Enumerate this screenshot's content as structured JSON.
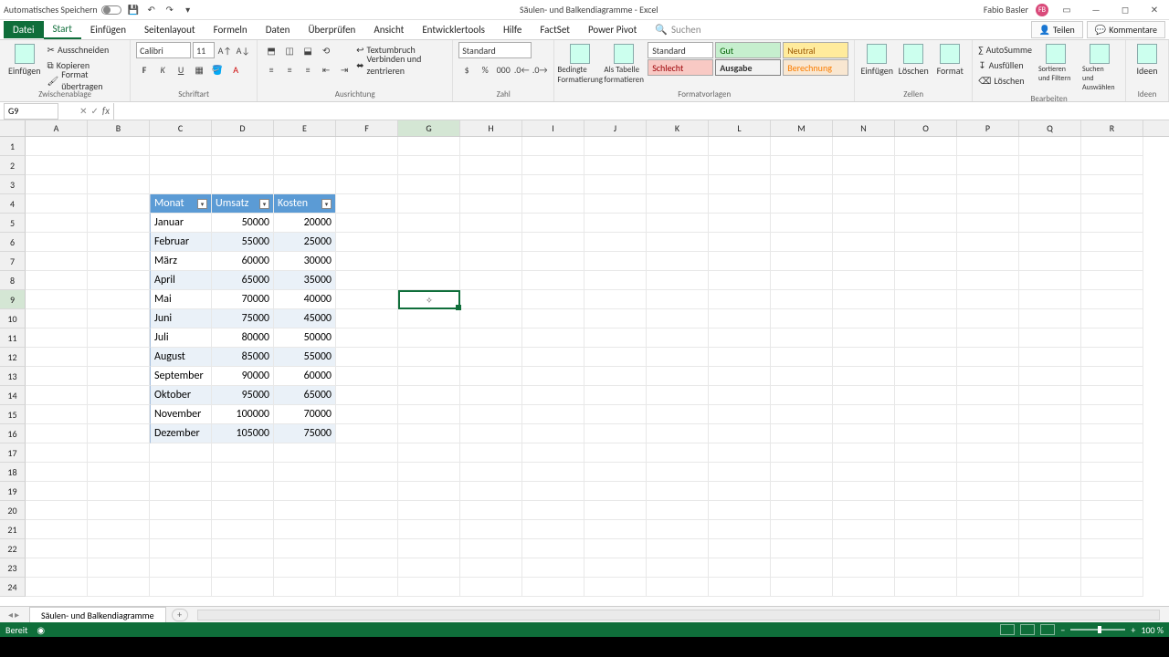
{
  "titlebar": {
    "autosave_label": "Automatisches Speichern",
    "doc_title": "Säulen- und Balkendiagramme - Excel",
    "user_name": "Fabio Basler",
    "avatar_initials": "FB"
  },
  "tabs": {
    "file": "Datei",
    "start": "Start",
    "einfugen": "Einfügen",
    "seitenlayout": "Seitenlayout",
    "formeln": "Formeln",
    "daten": "Daten",
    "uberprufen": "Überprüfen",
    "ansicht": "Ansicht",
    "entwicklertools": "Entwicklertools",
    "hilfe": "Hilfe",
    "factset": "FactSet",
    "powerpivot": "Power Pivot",
    "search_placeholder": "Suchen",
    "teilen": "Teilen",
    "kommentare": "Kommentare"
  },
  "ribbon": {
    "clipboard": {
      "paste": "Einfügen",
      "cut": "Ausschneiden",
      "copy": "Kopieren",
      "format_painter": "Format übertragen",
      "label": "Zwischenablage"
    },
    "font": {
      "name": "Calibri",
      "size": "11",
      "label": "Schriftart"
    },
    "alignment": {
      "wrap": "Textumbruch",
      "merge": "Verbinden und zentrieren",
      "label": "Ausrichtung"
    },
    "number": {
      "format": "Standard",
      "label": "Zahl"
    },
    "styles": {
      "cond": "Bedingte Formatierung",
      "astable": "Als Tabelle formatieren",
      "standard": "Standard",
      "schlecht": "Schlecht",
      "gut": "Gut",
      "ausgabe": "Ausgabe",
      "neutral": "Neutral",
      "berechnung": "Berechnung",
      "label": "Formatvorlagen"
    },
    "cells": {
      "insert": "Einfügen",
      "delete": "Löschen",
      "format": "Format",
      "label": "Zellen"
    },
    "editing": {
      "autosum": "AutoSumme",
      "fill": "Ausfüllen",
      "clear": "Löschen",
      "sort": "Sortieren und Filtern",
      "find": "Suchen und Auswählen",
      "label": "Bearbeiten"
    },
    "ideas": {
      "btn": "Ideen",
      "label": "Ideen"
    }
  },
  "namebox": "G9",
  "columns": [
    "A",
    "B",
    "C",
    "D",
    "E",
    "F",
    "G",
    "H",
    "I",
    "J",
    "K",
    "L",
    "M",
    "N",
    "O",
    "P",
    "Q",
    "R"
  ],
  "selected_col": "G",
  "selected_row": 9,
  "table": {
    "headers": [
      "Monat",
      "Umsatz",
      "Kosten"
    ],
    "rows": [
      [
        "Januar",
        "50000",
        "20000"
      ],
      [
        "Februar",
        "55000",
        "25000"
      ],
      [
        "März",
        "60000",
        "30000"
      ],
      [
        "April",
        "65000",
        "35000"
      ],
      [
        "Mai",
        "70000",
        "40000"
      ],
      [
        "Juni",
        "75000",
        "45000"
      ],
      [
        "Juli",
        "80000",
        "50000"
      ],
      [
        "August",
        "85000",
        "55000"
      ],
      [
        "September",
        "90000",
        "60000"
      ],
      [
        "Oktober",
        "95000",
        "65000"
      ],
      [
        "November",
        "100000",
        "70000"
      ],
      [
        "Dezember",
        "105000",
        "75000"
      ]
    ]
  },
  "sheet_tab": "Säulen- und Balkendiagramme",
  "status": {
    "ready": "Bereit",
    "zoom": "100 %"
  }
}
